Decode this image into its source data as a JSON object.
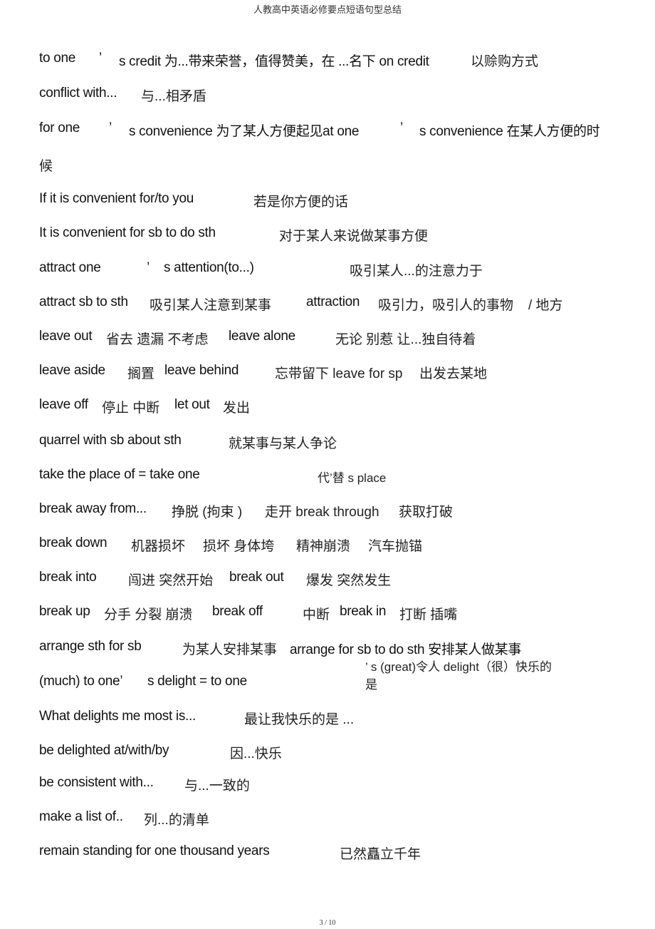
{
  "header": {
    "title": "人教高中英语必修要点短语句型总结"
  },
  "footer": {
    "page_indicator": "3 / 10"
  },
  "lines": [
    {
      "segs": [
        "to one",
        "’",
        "s credit 为...带来荣誉，值得赞美，在 ...名下 on credit",
        "以赊购方式"
      ]
    },
    {
      "segs": [
        "conflict with...",
        "与...相矛盾"
      ]
    },
    {
      "segs": [
        "for one",
        "’",
        "s convenience 为了某人方便起见at one",
        "’",
        "s convenience 在某人方便的时"
      ]
    },
    {
      "segs": [
        "候"
      ]
    },
    {
      "segs": [
        "If it is convenient for/to you",
        "若是你方便的话"
      ]
    },
    {
      "segs": [
        "It is convenient for sb to do sth",
        "对于某人来说做某事方便"
      ]
    },
    {
      "segs": [
        "attract one",
        "’",
        "s attention(to...)",
        "吸引某人...的注意力于"
      ]
    },
    {
      "segs": [
        "attract sb to sth",
        "吸引某人注意到某事",
        "attraction",
        "吸引力，吸引人的事物",
        "/ 地方"
      ]
    },
    {
      "segs": [
        "leave out",
        "省去  遗漏  不考虑",
        "leave alone",
        "无论  别惹  让...独自待着"
      ]
    },
    {
      "segs": [
        "leave aside",
        "搁置",
        "leave behind",
        "忘带留下 leave for sp",
        "出发去某地"
      ]
    },
    {
      "segs": [
        "leave off",
        "停止  中断",
        "let out",
        "发出"
      ]
    },
    {
      "segs": [
        "quarrel with sb about sth",
        "就某事与某人争论"
      ]
    },
    {
      "segs": [
        "take the place of = take one",
        "代’替 s place"
      ]
    },
    {
      "segs": [
        "break away from...",
        "挣脱 (拘束 )",
        "走开 break through",
        "获取打破"
      ]
    },
    {
      "segs": [
        "break down",
        "机器损坏",
        "损坏  身体垮",
        "精神崩溃",
        "汽车抛锚"
      ]
    },
    {
      "segs": [
        "break into",
        "闯进  突然开始",
        "break out",
        "爆发  突然发生"
      ]
    },
    {
      "segs": [
        "break up",
        "分手  分裂  崩溃",
        "break off",
        "中断",
        "break in",
        "打断  插嘴"
      ]
    },
    {
      "segs": [
        "arrange sth for sb",
        "为某人安排某事",
        "arrange for sb to do sth 安排某人做某事"
      ]
    },
    {
      "segs": [
        "’ s (great)令人 delight（很）快乐的"
      ]
    },
    {
      "segs": [
        "(much) to one’",
        "s delight = to one",
        "是"
      ]
    },
    {
      "segs": [
        "What delights me most is...",
        "最让我快乐的是 ..."
      ]
    },
    {
      "segs": [
        "be delighted at/with/by",
        "因...快乐"
      ]
    },
    {
      "segs": [
        "be consistent with...",
        "与...一致的"
      ]
    },
    {
      "segs": [
        "make a list of..",
        "列...的清单"
      ]
    },
    {
      "segs": [
        "remain standing for one thousand years",
        "已然矗立千年"
      ]
    }
  ]
}
